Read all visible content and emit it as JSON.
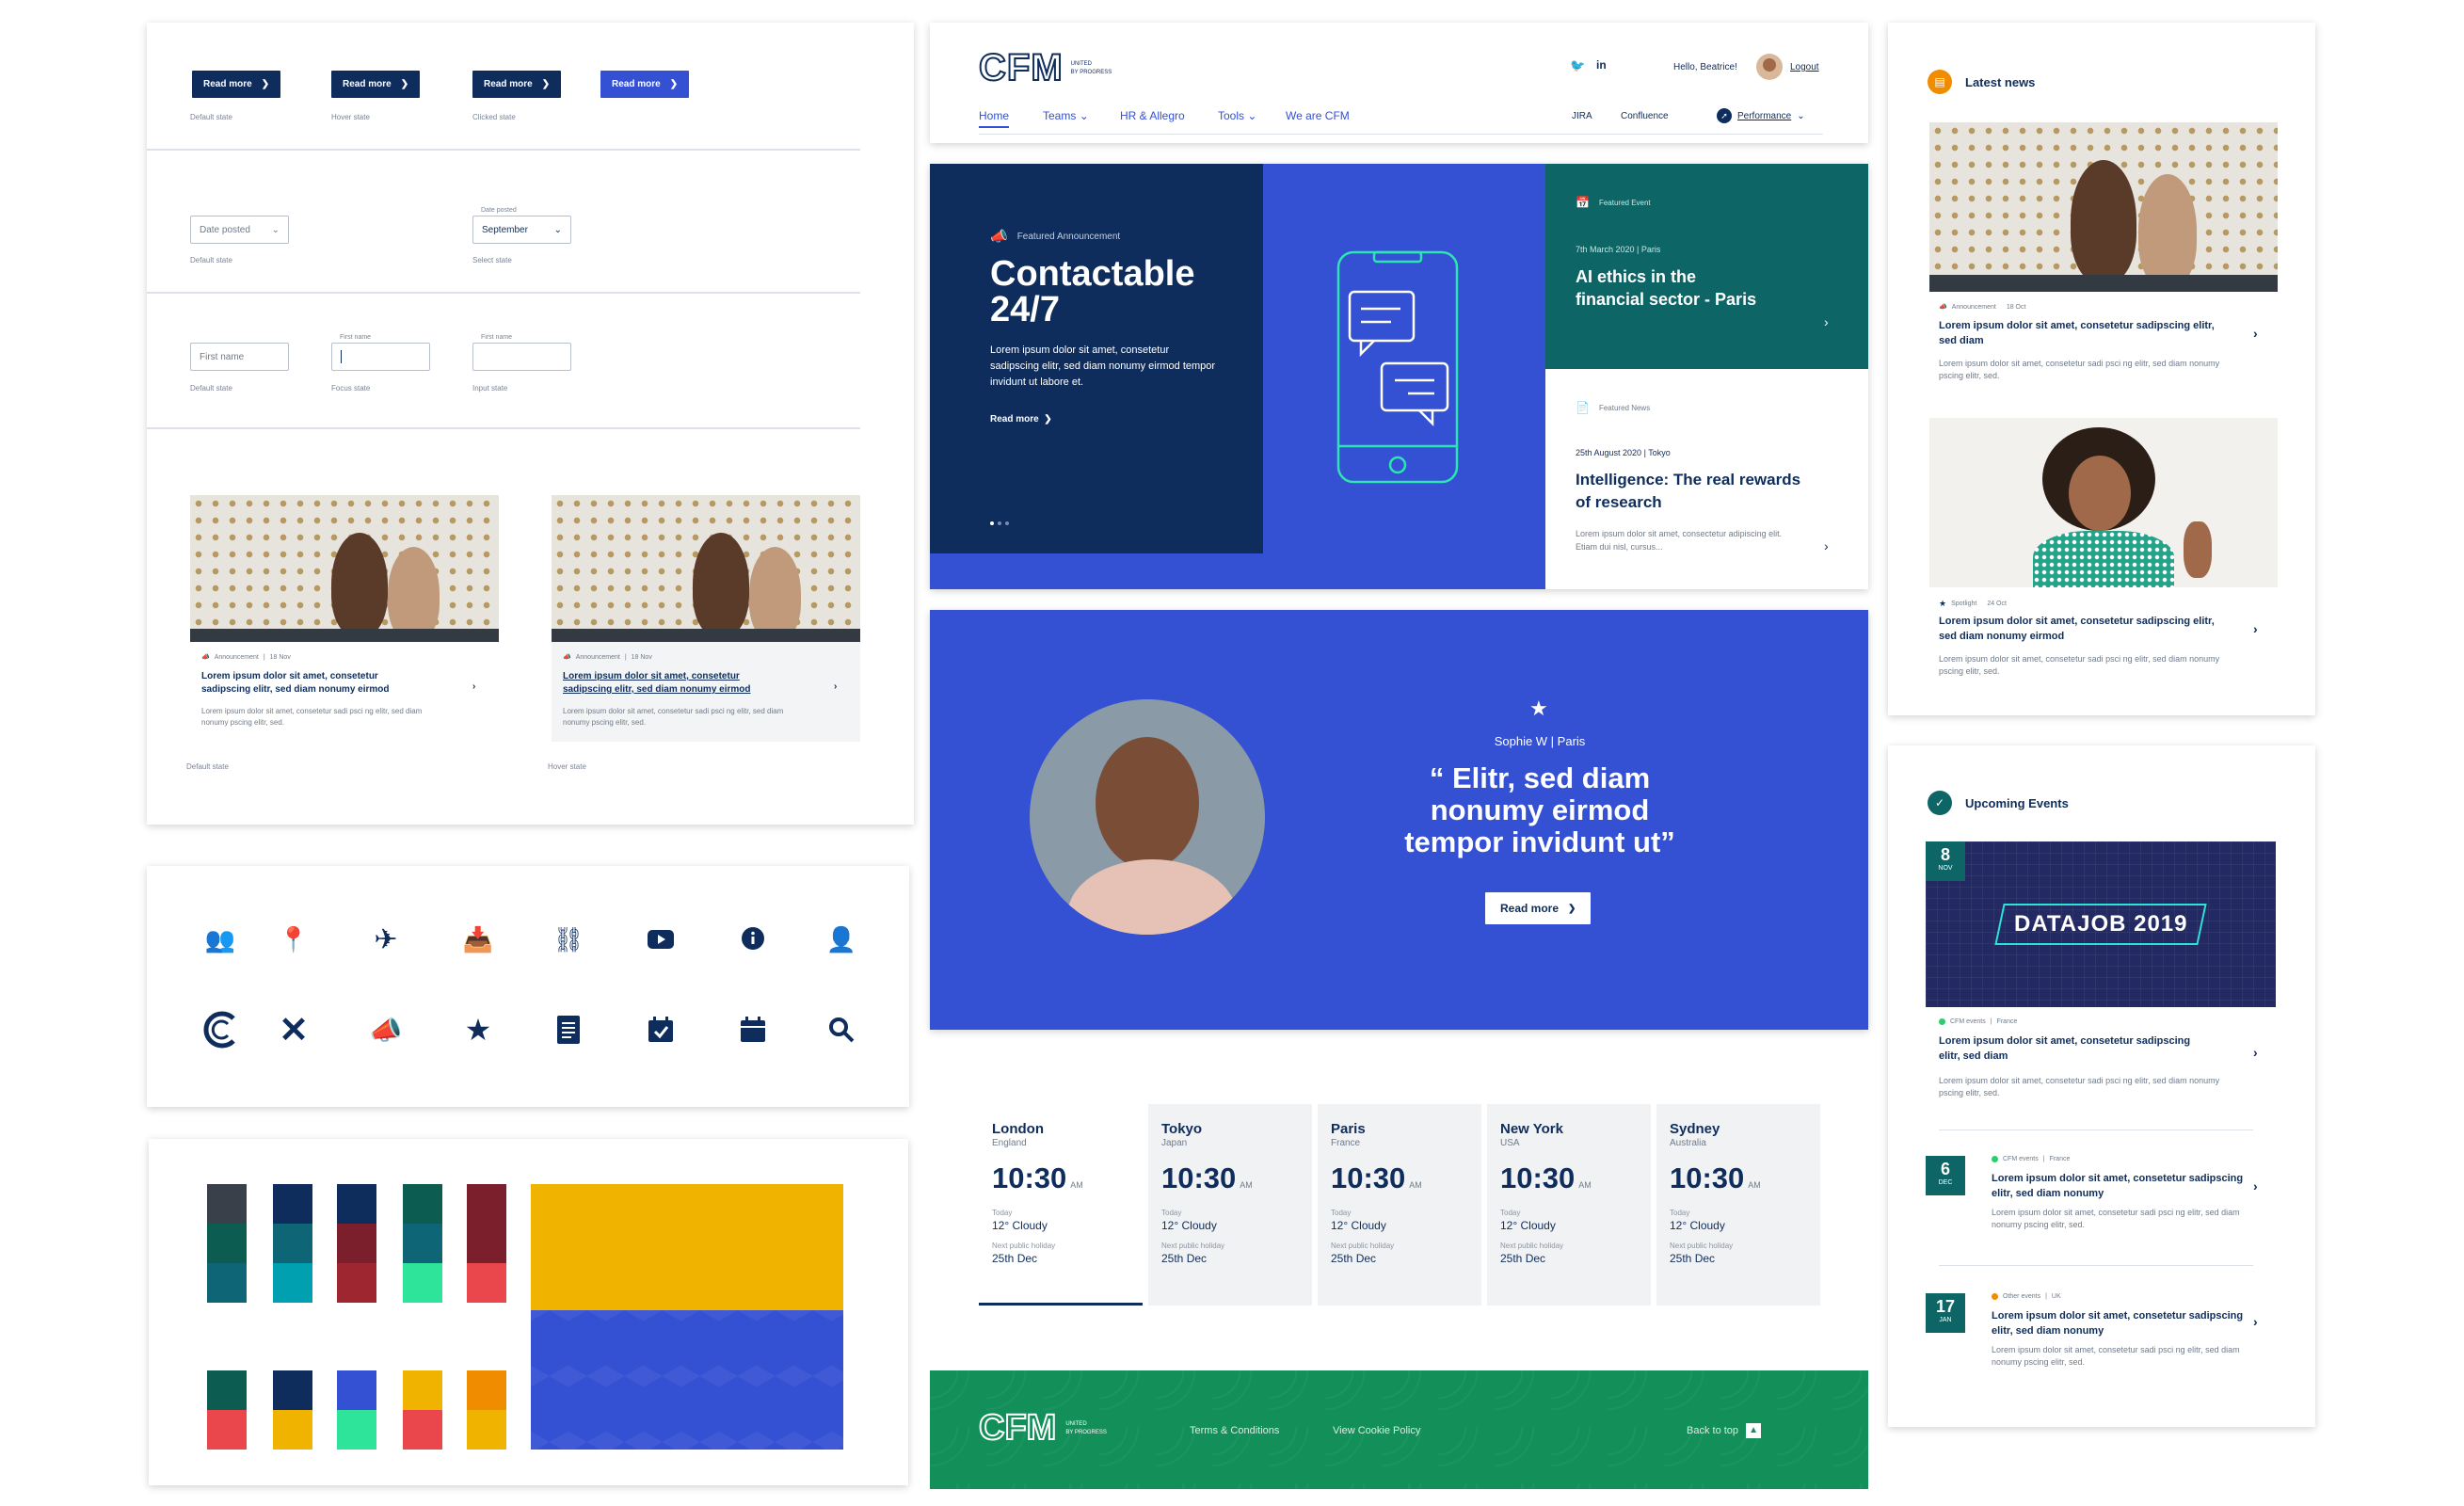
{
  "components": {
    "buttons": [
      {
        "label": "Read more",
        "state": "Default state",
        "color": "#0f2d5c"
      },
      {
        "label": "Read more",
        "state": "Hover state",
        "color": "#0f2d5c"
      },
      {
        "label": "Read more",
        "state": "Clicked state",
        "color": "#0f2d5c"
      },
      {
        "label": "Read more",
        "state": "",
        "color": "#3450d3"
      }
    ],
    "dropdowns": [
      {
        "label": "",
        "value": "Date posted",
        "state": "Default state"
      },
      {
        "label": "Date posted",
        "value": "September",
        "state": "Select state"
      }
    ],
    "inputs": [
      {
        "label": "",
        "value": "First name",
        "state": "Default state"
      },
      {
        "label": "First name",
        "value": "",
        "state": "Focus state"
      },
      {
        "label": "First name",
        "value": "",
        "state": "Input state"
      }
    ],
    "cards": [
      {
        "tag": "Announcement",
        "date": "18 Nov",
        "title": "Lorem ipsum dolor sit amet, consetetur sadipscing elitr, sed diam nonumy eirmod",
        "body": "Lorem ipsum dolor sit amet, consetetur sadi psci ng elitr, sed diam nonumy pscing elitr, sed.",
        "state": "Default state"
      },
      {
        "tag": "Announcement",
        "date": "18 Nov",
        "title": "Lorem ipsum dolor sit amet, consetetur sadipscing elitr, sed diam nonumy eirmod",
        "body": "Lorem ipsum dolor sit amet, consetetur sadi psci ng elitr, sed diam nonumy pscing elitr, sed.",
        "state": "Hover state"
      }
    ],
    "icons": [
      "people-icon",
      "location-pin-icon",
      "airplane-icon",
      "inbox-icon",
      "org-chart-icon",
      "youtube-icon",
      "info-chat-icon",
      "user-badge-icon",
      "cfm-logo-icon",
      "close-icon",
      "megaphone-icon",
      "star-icon",
      "document-icon",
      "calendar-check-icon",
      "calendar-icon",
      "search-icon"
    ],
    "palette_small": [
      "#3a4049",
      "#0f2d5c",
      "#0f2d5c",
      "#0d5c52",
      "#7a1f2b",
      "#0d5c52",
      "#0d6576",
      "#7a1f2b",
      "#0d6576",
      "#7a1f2b",
      "#0d6576",
      "#00a0b0",
      "#9e2630",
      "#2ee39a",
      "#e9474b"
    ],
    "palette_bottom": [
      "#0d5c52",
      "#0f2d5c",
      "#3450d3",
      "#f0b400",
      "#f08c00",
      "#e9474b",
      "#f0b400",
      "#2ee39a",
      "#e9474b",
      "#f0b400"
    ],
    "big_yellow": "#f0b400",
    "big_blue": "#3450d3"
  },
  "header": {
    "logo": "CFM",
    "tagline_1": "UNITED",
    "tagline_2": "BY PROGRESS",
    "greeting": "Hello, Beatrice!",
    "logout": "Logout",
    "nav": [
      "Home",
      "Teams",
      "HR & Allegro",
      "Tools",
      "We are CFM"
    ],
    "quick_links": [
      "JIRA",
      "Confluence"
    ],
    "performance": "Performance"
  },
  "hero": {
    "tag": "Featured Announcement",
    "title_1": "Contactable",
    "title_2": "24/7",
    "body": "Lorem ipsum dolor sit amet, consetetur sadipscing elitr, sed diam nonumy eirmod tempor invidunt ut labore et.",
    "cta": "Read more",
    "event_tag": "Featured Event",
    "event_meta": "7th March 2020 | Paris",
    "event_title": "AI ethics in the financial sector - Paris",
    "news_tag": "Featured News",
    "news_meta": "25th August 2020 | Tokyo",
    "news_title": "Intelligence: The real rewards of research",
    "news_body": "Lorem ipsum dolor sit amet, consectetur adipiscing elit. Etiam dui nisl, cursus..."
  },
  "spotlight": {
    "name": "Sophie W | Paris",
    "quote": "“ Elitr, sed diam nonumy eirmod tempor invidunt ut”",
    "cta": "Read more"
  },
  "cities": [
    {
      "name": "London",
      "country": "England",
      "time": "10:30",
      "ampm": "AM",
      "today": "Today",
      "weather": "12° Cloudy",
      "holiday_label": "Next public holiday",
      "holiday": "25th Dec"
    },
    {
      "name": "Tokyo",
      "country": "Japan",
      "time": "10:30",
      "ampm": "AM",
      "today": "Today",
      "weather": "12° Cloudy",
      "holiday_label": "Next public holiday",
      "holiday": "25th Dec"
    },
    {
      "name": "Paris",
      "country": "France",
      "time": "10:30",
      "ampm": "AM",
      "today": "Today",
      "weather": "12° Cloudy",
      "holiday_label": "Next public holiday",
      "holiday": "25th Dec"
    },
    {
      "name": "New York",
      "country": "USA",
      "time": "10:30",
      "ampm": "AM",
      "today": "Today",
      "weather": "12° Cloudy",
      "holiday_label": "Next public holiday",
      "holiday": "25th Dec"
    },
    {
      "name": "Sydney",
      "country": "Australia",
      "time": "10:30",
      "ampm": "AM",
      "today": "Today",
      "weather": "12° Cloudy",
      "holiday_label": "Next public holiday",
      "holiday": "25th Dec"
    }
  ],
  "footer": {
    "logo": "CFM",
    "tagline_1": "UNITED",
    "tagline_2": "BY PROGRESS",
    "terms": "Terms & Conditions",
    "cookies": "View Cookie Policy",
    "back_to_top": "Back to top"
  },
  "latest_news": {
    "heading": "Latest news",
    "items": [
      {
        "tag": "Announcement",
        "date": "18 Oct",
        "title": "Lorem ipsum dolor sit amet, consetetur sadipscing elitr, sed diam",
        "body": "Lorem ipsum dolor sit amet, consetetur sadi psci ng elitr, sed diam nonumy pscing elitr, sed."
      },
      {
        "tag": "Spotlight",
        "date": "24 Oct",
        "title": "Lorem ipsum dolor sit amet, consetetur sadipscing elitr, sed diam nonumy eirmod",
        "body": "Lorem ipsum dolor sit amet, consetetur sadi psci ng elitr, sed diam nonumy pscing elitr, sed."
      }
    ]
  },
  "events": {
    "heading": "Upcoming Events",
    "banner_text": "DATAJOB 2019",
    "items": [
      {
        "day": "8",
        "month": "NOV",
        "tag": "CFM events",
        "place": "France",
        "dot": "#2ecc71",
        "title": "Lorem ipsum dolor sit amet, consetetur sadipscing elitr, sed diam",
        "body": "Lorem ipsum dolor sit amet, consetetur sadi psci ng elitr, sed diam nonumy pscing elitr, sed."
      },
      {
        "day": "6",
        "month": "DEC",
        "tag": "CFM events",
        "place": "France",
        "dot": "#2ecc71",
        "title": "Lorem ipsum dolor sit amet, consetetur sadipscing elitr, sed diam nonumy",
        "body": "Lorem ipsum dolor sit amet, consetetur sadi psci ng elitr, sed diam nonumy pscing elitr, sed."
      },
      {
        "day": "17",
        "month": "JAN",
        "tag": "Other events",
        "place": "UK",
        "dot": "#f08c00",
        "title": "Lorem ipsum dolor sit amet, consetetur sadipscing elitr, sed diam nonumy",
        "body": "Lorem ipsum dolor sit amet, consetetur sadi psci ng elitr, sed diam nonumy pscing elitr, sed."
      }
    ]
  }
}
